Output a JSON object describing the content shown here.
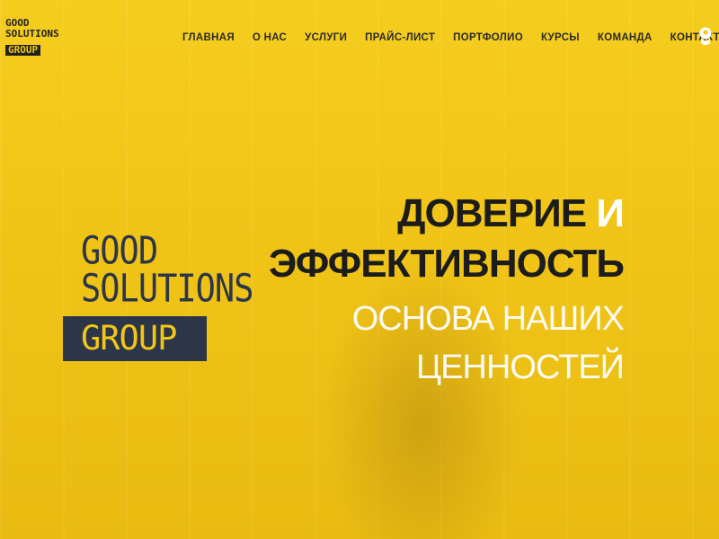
{
  "brand": {
    "small_logo": {
      "line1": "GOOD",
      "line2": "SOLUTIONS",
      "line3": "GROUP"
    },
    "big_logo": {
      "line1": "GOOD",
      "line2": "SOLUTIONS",
      "line3": "GROUP"
    },
    "colors": {
      "accent": "#f2c619",
      "dark": "#2c3648",
      "text": "#1c1c1c"
    }
  },
  "nav": {
    "items": [
      {
        "label": "ГЛАВНАЯ"
      },
      {
        "label": "О НАС"
      },
      {
        "label": "УСЛУГИ"
      },
      {
        "label": "ПРАЙС-ЛИСТ"
      },
      {
        "label": "ПОРТФОЛИО"
      },
      {
        "label": "КУРСЫ"
      },
      {
        "label": "КОМАНДА"
      },
      {
        "label": "КОНТАКТЫ"
      }
    ],
    "account_icon": "user-icon"
  },
  "hero": {
    "title_word1": "ДОВЕРИЕ",
    "title_and": "И",
    "title_word2": "ЭФФЕКТИВНОСТЬ",
    "subtitle_line1": "ОСНОВА НАШИХ",
    "subtitle_line2": "ЦЕННОСТЕЙ"
  }
}
